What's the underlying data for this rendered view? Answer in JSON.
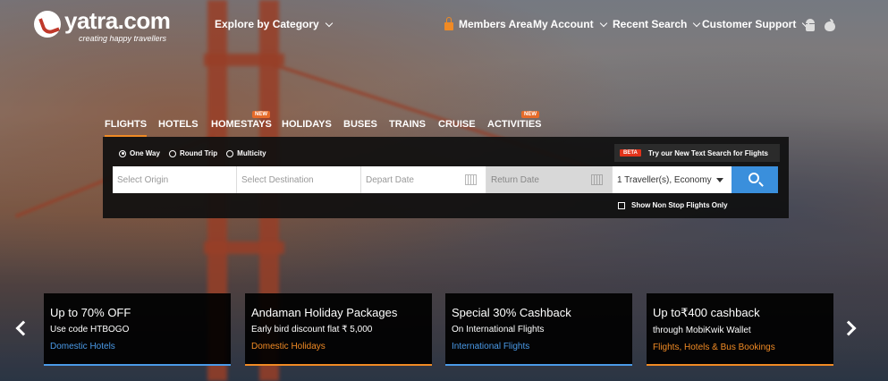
{
  "logo": {
    "text": "yatra.com",
    "tagline": "creating happy travellers"
  },
  "header": {
    "explore": "Explore by Category",
    "members": "Members Area",
    "account": "My Account",
    "recent": "Recent Search",
    "support": "Customer Support",
    "apps": [
      "android-icon",
      "apple-icon"
    ]
  },
  "tabs": [
    {
      "label": "FLIGHTS",
      "active": true,
      "new": false
    },
    {
      "label": "HOTELS",
      "active": false,
      "new": false
    },
    {
      "label": "HOMESTAYS",
      "active": false,
      "new": true
    },
    {
      "label": "HOLIDAYS",
      "active": false,
      "new": false
    },
    {
      "label": "BUSES",
      "active": false,
      "new": false
    },
    {
      "label": "TRAINS",
      "active": false,
      "new": false
    },
    {
      "label": "CRUISE",
      "active": false,
      "new": false
    },
    {
      "label": "ACTIVITIES",
      "active": false,
      "new": true
    }
  ],
  "new_badge": "NEW",
  "search": {
    "trip_types": [
      {
        "label": "One Way",
        "selected": true
      },
      {
        "label": "Round Trip",
        "selected": false
      },
      {
        "label": "Multicity",
        "selected": false
      }
    ],
    "beta_badge": "BETA",
    "beta_text": "Try our New Text Search for Flights",
    "origin_placeholder": "Select Origin",
    "destination_placeholder": "Select Destination",
    "depart_placeholder": "Depart Date",
    "return_placeholder": "Return Date",
    "traveller": "1 Traveller(s), Economy",
    "nonstop": "Show Non Stop Flights Only"
  },
  "offers": [
    {
      "title": "Up to 70% OFF",
      "sub": "Use code HTBOGO",
      "category": "Domestic Hotels",
      "color": "#4a9ae8"
    },
    {
      "title": "Andaman Holiday Packages",
      "sub": "Early bird discount flat ₹ 5,000",
      "category": "Domestic Holidays",
      "color": "#f08a24"
    },
    {
      "title": "Special 30% Cashback",
      "sub": "On International Flights",
      "category": "International Flights",
      "color": "#4a9ae8"
    },
    {
      "title": "Up to₹400 cashback",
      "sub": "through MobiKwik Wallet",
      "category": "Flights, Hotels & Bus Bookings",
      "color": "#f08a24"
    }
  ]
}
